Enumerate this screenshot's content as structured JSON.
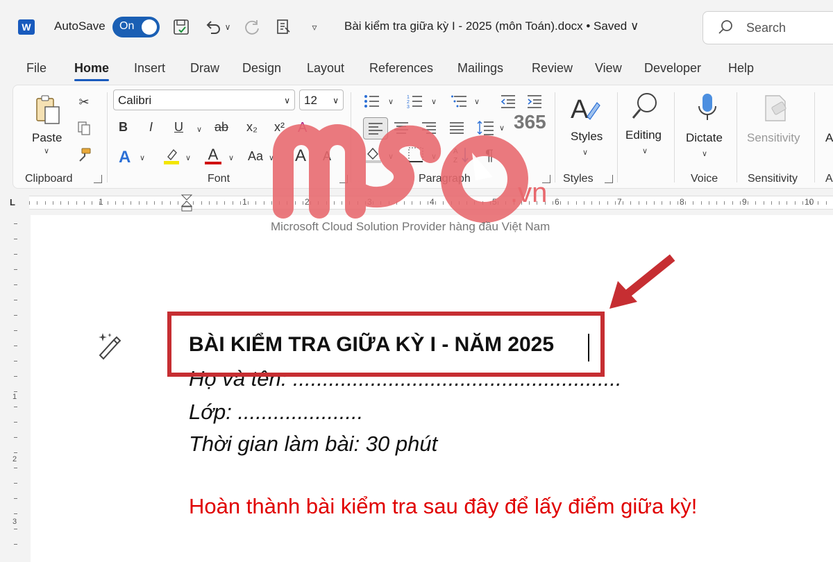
{
  "titlebar": {
    "autosave_label": "AutoSave",
    "toggle_label": "On",
    "doc_title": "Bài kiểm tra giữa kỳ I - 2025 (môn Toán).docx • Saved ∨",
    "search_placeholder": "Search"
  },
  "tabs": [
    "File",
    "Home",
    "Insert",
    "Draw",
    "Design",
    "Layout",
    "References",
    "Mailings",
    "Review",
    "View",
    "Developer",
    "Help"
  ],
  "active_tab": "Home",
  "ribbon": {
    "paste_label": "Paste",
    "clipboard_label": "Clipboard",
    "font_name": "Calibri",
    "font_size": "12",
    "font_label": "Font",
    "paragraph_label": "Paragraph",
    "styles_label": "Styles",
    "styles_group_label": "Styles",
    "editing_label": "Editing",
    "dictate_label": "Dictate",
    "voice_label": "Voice",
    "sensitivity_label": "Sensitivity",
    "sensitivity_group_label": "Sensitivity",
    "bold": "B",
    "italic": "I",
    "underline": "U",
    "strike": "ab",
    "subscript": "x₂",
    "superscript": "x²",
    "change_case": "Aa",
    "grow_font": "A",
    "shrink_font": "A",
    "text_effects": "A",
    "font_color": "A",
    "pilcrow": "¶"
  },
  "ruler": {
    "numbers": [
      "1",
      "1",
      "2",
      "3",
      "4",
      "5",
      "6",
      "7",
      "8",
      "9",
      "10"
    ],
    "vnumbers": [
      "1",
      "2",
      "3"
    ]
  },
  "document": {
    "heading": "BÀI KIỂM TRA GIỮA KỲ I - NĂM 2025",
    "line1": "Họ và tên: .......................................................",
    "line2": "Lớp: .....................",
    "line3": "Thời gian làm bài: 30 phút",
    "red_line": "Hoàn thành bài kiểm tra sau đây để lấy điểm giữa kỳ!"
  },
  "watermark": {
    "brand": "mso",
    "domain": ".vn",
    "badge": "365",
    "subtitle": "Microsoft Cloud Solution Provider hàng đầu Việt Nam"
  },
  "colors": {
    "accent": "#185abd",
    "highlight_box": "#c62e32",
    "red_text": "#e00000",
    "watermark": "#e8686d"
  }
}
